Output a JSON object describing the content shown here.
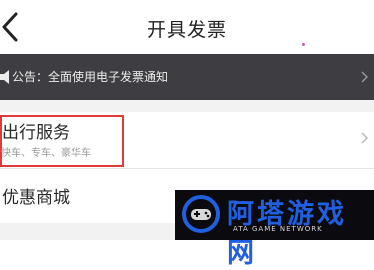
{
  "header": {
    "title": "开具发票"
  },
  "notice": {
    "text": "公告：全面使用电子发票通知"
  },
  "items": [
    {
      "title": "出行服务",
      "subtitle": "快车、专车、豪华车"
    },
    {
      "title": "优惠商城"
    }
  ],
  "watermark": {
    "name": "阿塔游戏网",
    "sub": "ATA GAME NETWORK"
  },
  "colors": {
    "notice_bg": "#3e3e42",
    "highlight": "#e03a3a",
    "brand_blue": "#1f5fe0"
  }
}
